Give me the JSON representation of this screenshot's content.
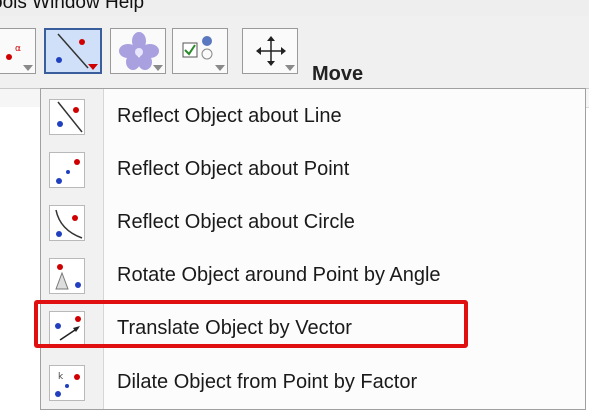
{
  "menubar": {
    "text": "ools Window Help"
  },
  "toolbar": {
    "active_tool_label": "Move",
    "buttons": [
      {
        "name": "point-tool-icon"
      },
      {
        "name": "reflect-line-icon"
      },
      {
        "name": "flower-icon"
      },
      {
        "name": "checkbox-icon"
      },
      {
        "name": "move-icon"
      }
    ]
  },
  "dropdown": {
    "items": [
      {
        "label": "Reflect Object about Line",
        "icon": "reflect-line-icon"
      },
      {
        "label": "Reflect Object about Point",
        "icon": "reflect-point-icon"
      },
      {
        "label": "Reflect Object about Circle",
        "icon": "reflect-circle-icon"
      },
      {
        "label": "Rotate Object around Point by Angle",
        "icon": "rotate-icon"
      },
      {
        "label": "Translate Object by Vector",
        "icon": "translate-vector-icon"
      },
      {
        "label": "Dilate Object from Point by Factor",
        "icon": "dilate-icon"
      }
    ],
    "highlight_color": "#e01010"
  },
  "colors": {
    "accent": "#3a5e9c",
    "point_blue": "#2040c0",
    "point_red": "#d00000"
  }
}
